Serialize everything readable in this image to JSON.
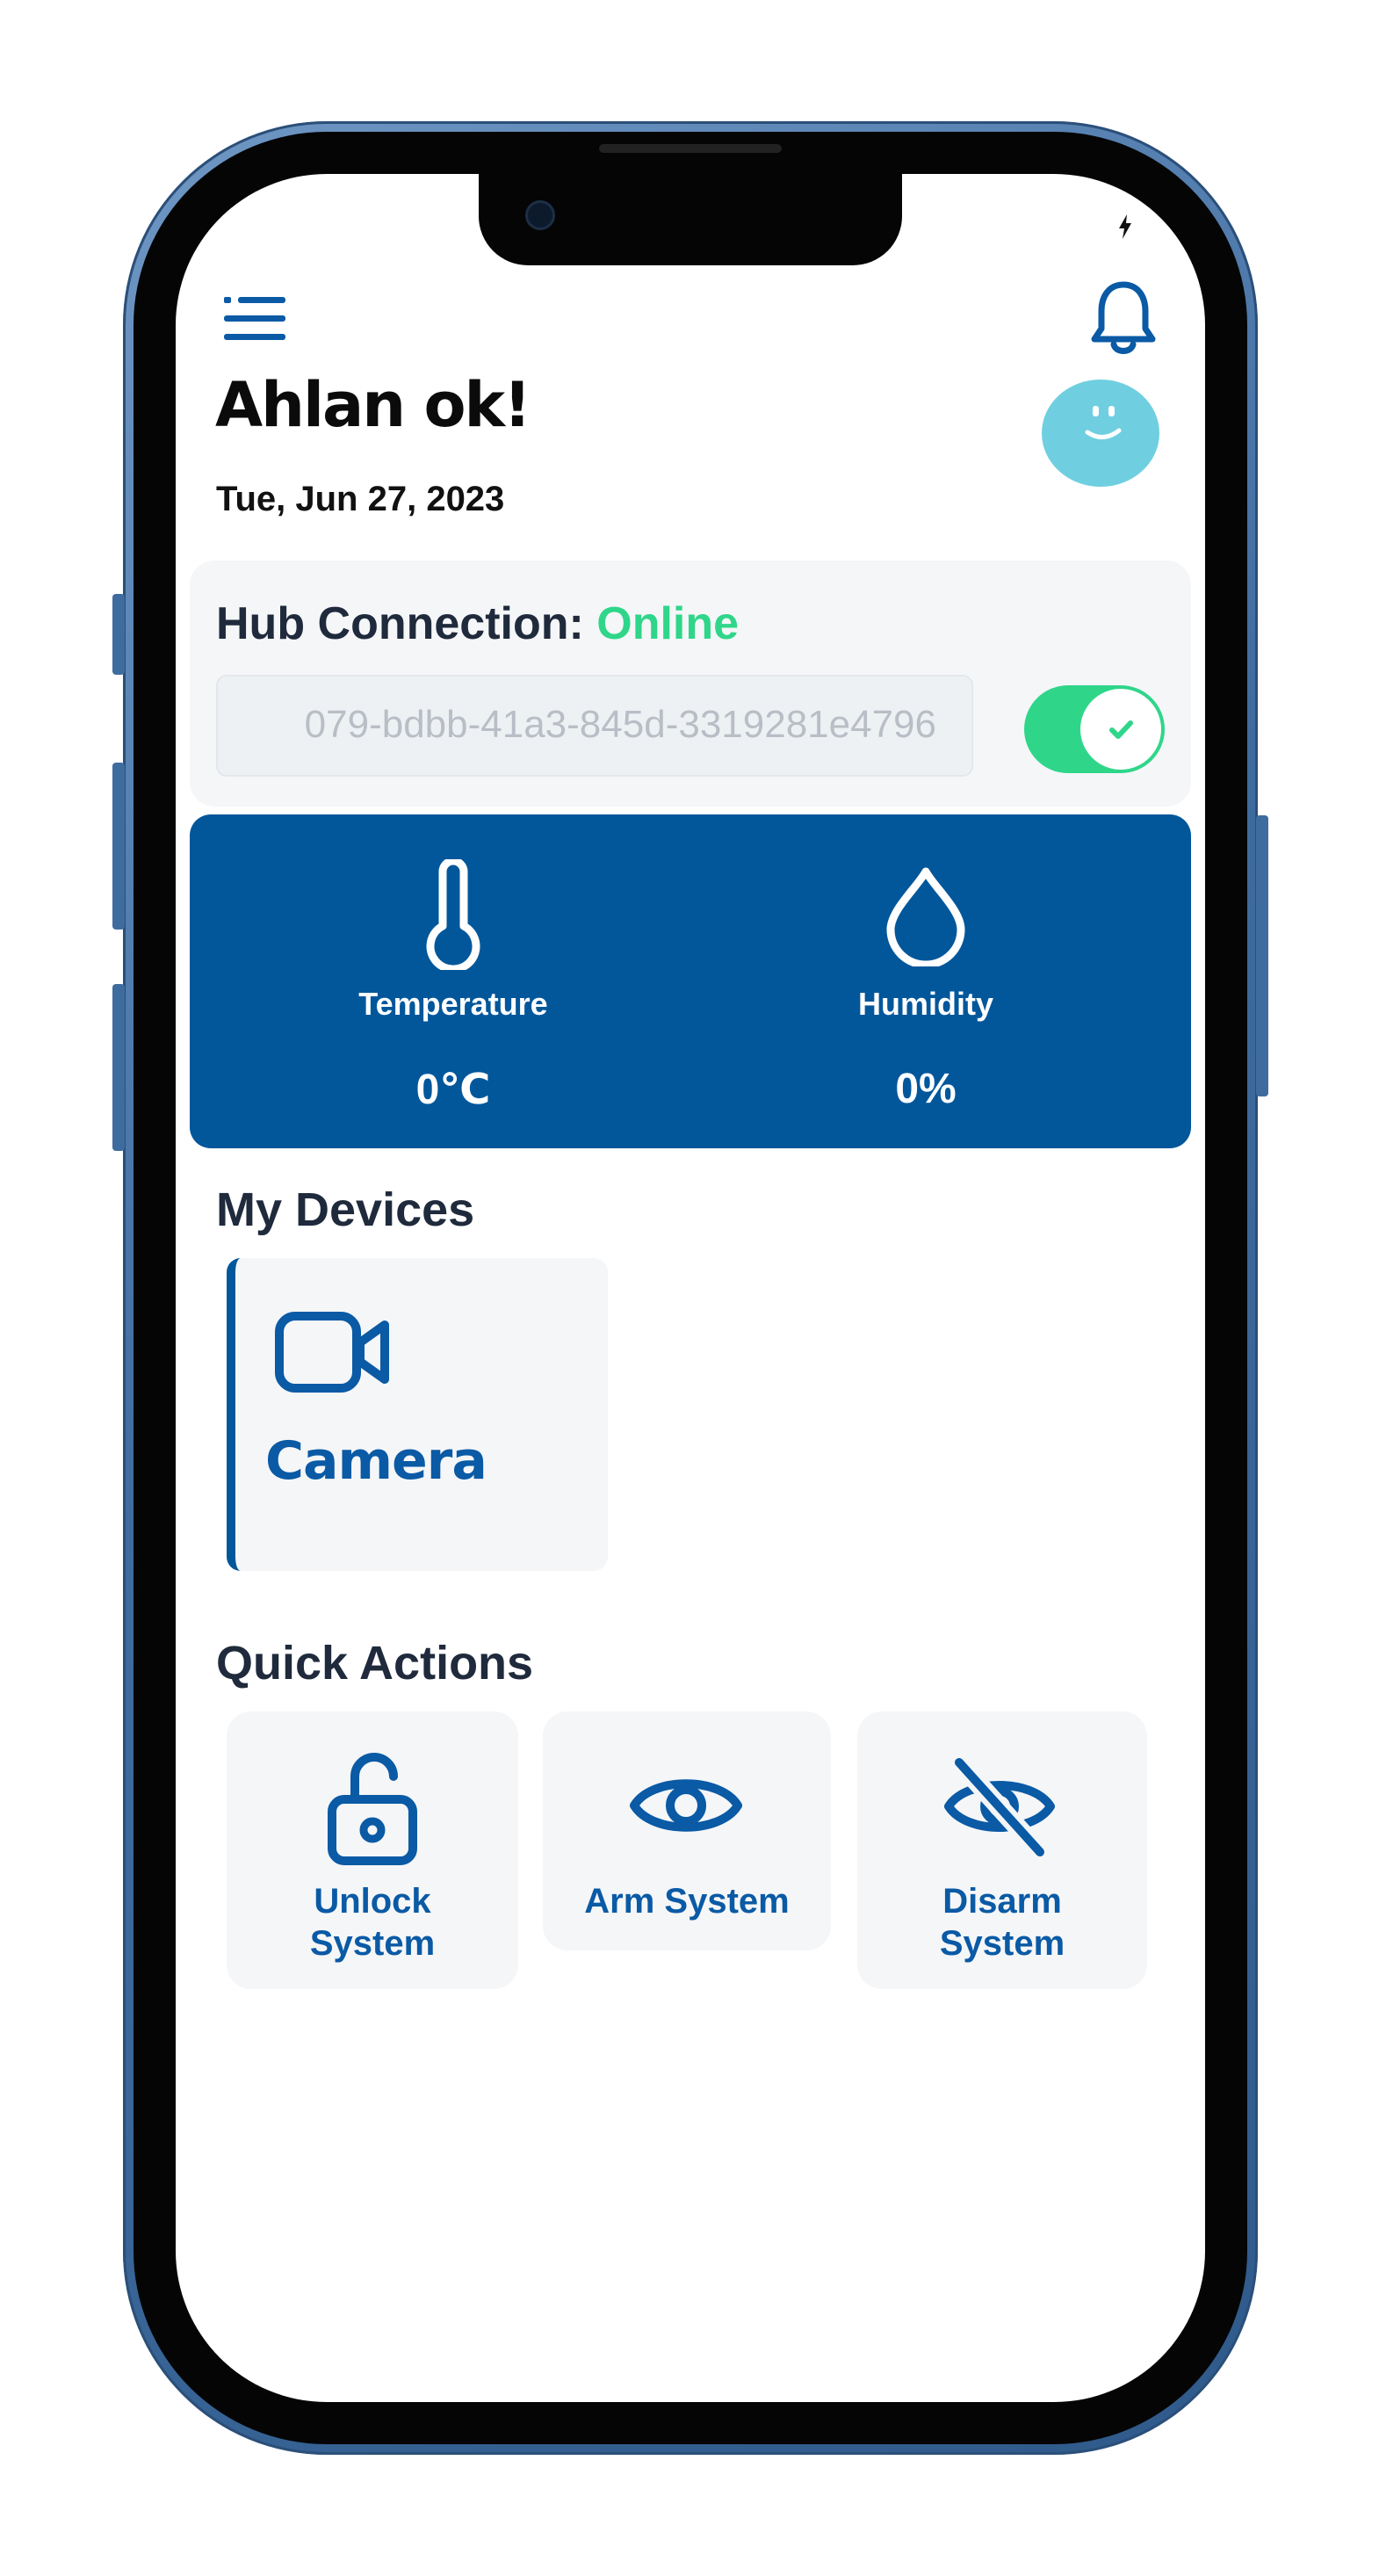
{
  "header": {
    "greeting": "Ahlan ok!",
    "date": "Tue, Jun 27, 2023"
  },
  "hub": {
    "title_prefix": "Hub Connection: ",
    "status": "Online",
    "hub_id_value": "079-bdbb-41a3-845d-3319281e4796",
    "toggle_on": true
  },
  "sensors": {
    "temperature_label": "Temperature",
    "temperature_value": "0℃",
    "humidity_label": "Humidity",
    "humidity_value": "0%"
  },
  "devices": {
    "title": "My Devices",
    "items": [
      {
        "label": "Camera",
        "icon": "video-camera-icon"
      }
    ]
  },
  "quick_actions": {
    "title": "Quick Actions",
    "items": [
      {
        "line1": "Unlock",
        "line2": "System",
        "icon": "unlock-icon"
      },
      {
        "line1": "Arm System",
        "line2": "",
        "icon": "eye-icon"
      },
      {
        "line1": "Disarm",
        "line2": "System",
        "icon": "eye-off-icon"
      }
    ]
  },
  "colors": {
    "primary_blue": "#02579b",
    "online_green": "#2fd68a",
    "avatar_cyan": "#6fcfe0",
    "frame_blue": "#3f6c9f"
  }
}
